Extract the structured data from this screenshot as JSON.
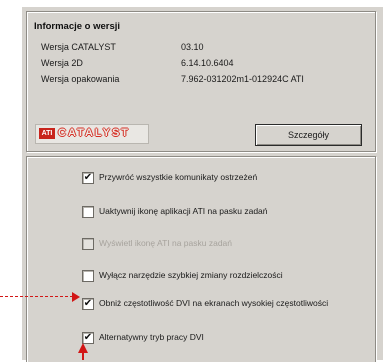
{
  "info": {
    "title": "Informacje o wersji",
    "rows": [
      {
        "label": "Wersja CATALYST",
        "value": "03.10"
      },
      {
        "label": "Wersja 2D",
        "value": "6.14.10.6404"
      },
      {
        "label": "Wersja opakowania",
        "value": "7.962-031202m1-012924C ATI"
      }
    ],
    "logo_mark": "ATI",
    "logo_word": "CATALYST",
    "details_button": "Szczegóły"
  },
  "options": [
    {
      "label": "Przywróć wszystkie komunikaty ostrzeżeń",
      "checked": true,
      "enabled": true
    },
    {
      "label": "Uaktywnij ikonę aplikacji ATI na pasku zadań",
      "checked": false,
      "enabled": true
    },
    {
      "label": "Wyświetl ikonę ATI na pasku zadań",
      "checked": false,
      "enabled": false
    },
    {
      "label": "Wyłącz narzędzie szybkiej zmiany rozdzielczości",
      "checked": false,
      "enabled": true
    },
    {
      "label": "Obniż częstotliwość DVI na ekranach wysokiej częstotliwości",
      "checked": true,
      "enabled": true
    },
    {
      "label": "Alternatywny tryb pracy DVI",
      "checked": true,
      "enabled": true
    }
  ],
  "colors": {
    "annotation_arrow": "#d21616",
    "dialog_bg": "#d6d3ce",
    "logo_red": "#c8241c"
  }
}
